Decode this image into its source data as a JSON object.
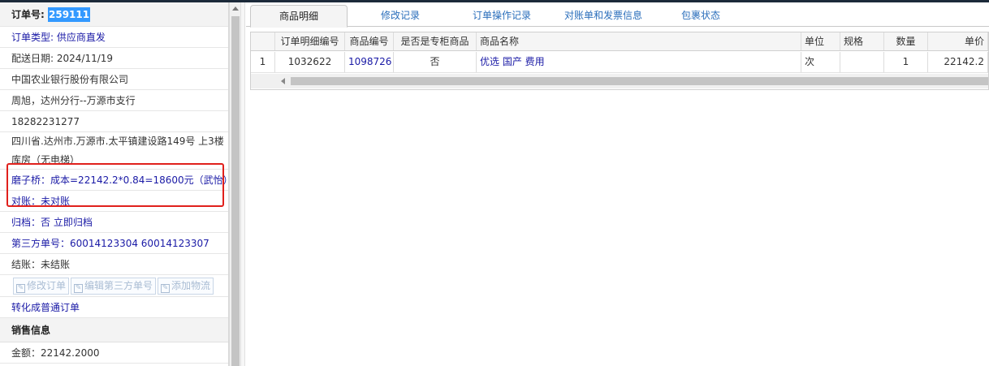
{
  "left": {
    "order_no_label": "订单号:",
    "order_no": "259111",
    "order_type": "订单类型:  供应商直发",
    "delivery_date": "配送日期: 2024/11/19",
    "company": "中国农业银行股份有限公司",
    "contact": "周旭，达州分行--万源市支行",
    "phone": "18282231277",
    "address": "四川省.达州市.万源市.太平镇建设路149号 上3楼库房（无电梯）",
    "cost_note": "磨子桥：成本=22142.2*0.84=18600元（武怡）",
    "reconcile": "对账：未对账",
    "archive": "归档：否 立即归档",
    "third_party": "第三方单号：60014123304 60014123307",
    "settle": "结账：未结账",
    "buttons": [
      "修改订单",
      "编辑第三方单号",
      "添加物流"
    ],
    "convert": "转化成普通订单",
    "sales_section": "销售信息",
    "amount": "金额：22142.2000"
  },
  "tabs": [
    "商品明细",
    "修改记录",
    "订单操作记录",
    "对账单和发票信息",
    "包裹状态"
  ],
  "grid": {
    "headers": [
      "",
      "订单明细编号",
      "商品编号",
      "是否是专柜商品",
      "商品名称",
      "单位",
      "规格",
      "数量",
      "单价"
    ],
    "rows": [
      [
        "1",
        "1032622",
        "1098726",
        "否",
        "优选 国产 费用",
        "次",
        "",
        "1",
        "22142.2"
      ]
    ]
  },
  "colors": {
    "accent": "#3399ff",
    "link": "#1a1aa6",
    "highlight_box": "#e0201c"
  }
}
